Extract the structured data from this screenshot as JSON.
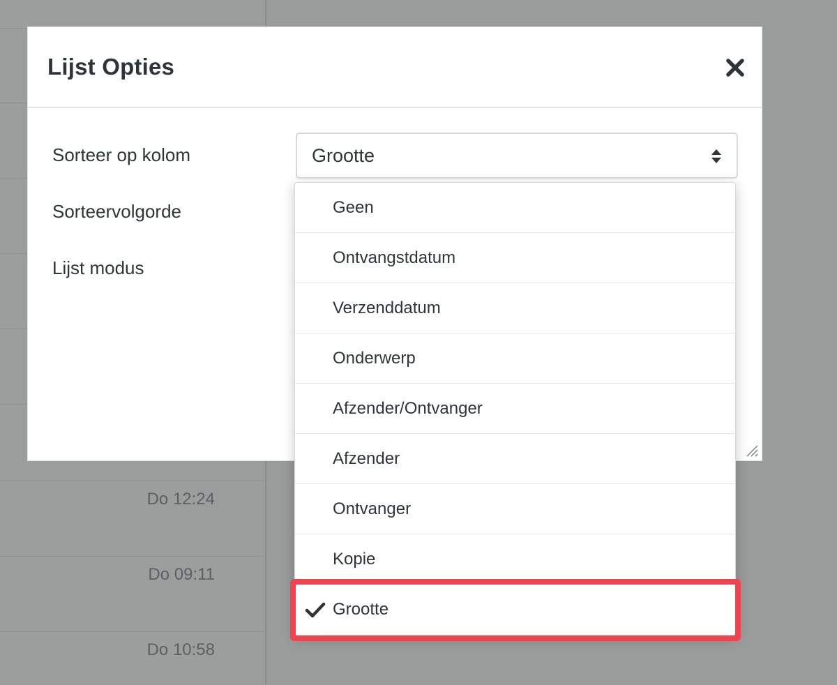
{
  "dialog": {
    "title": "Lijst Opties",
    "close_icon": "close-icon",
    "fields": {
      "sort_column_label": "Sorteer op kolom",
      "sort_order_label": "Sorteervolgorde",
      "list_mode_label": "Lijst modus"
    },
    "select": {
      "value": "Grootte",
      "icon": "updown-icon"
    }
  },
  "dropdown": {
    "options": [
      {
        "label": "Geen",
        "selected": false
      },
      {
        "label": "Ontvangstdatum",
        "selected": false
      },
      {
        "label": "Verzenddatum",
        "selected": false
      },
      {
        "label": "Onderwerp",
        "selected": false
      },
      {
        "label": "Afzender/Ontvanger",
        "selected": false
      },
      {
        "label": "Afzender",
        "selected": false
      },
      {
        "label": "Ontvanger",
        "selected": false
      },
      {
        "label": "Kopie",
        "selected": false
      },
      {
        "label": "Grootte",
        "selected": true
      }
    ],
    "check_icon": "check-icon",
    "highlight_color": "#ef4350"
  },
  "background_list": {
    "times": [
      "Do 12:24",
      "Do 09:11",
      "Do 10:58"
    ]
  },
  "colors": {
    "overlay": "#9a9c9c",
    "text": "#2c363a"
  }
}
